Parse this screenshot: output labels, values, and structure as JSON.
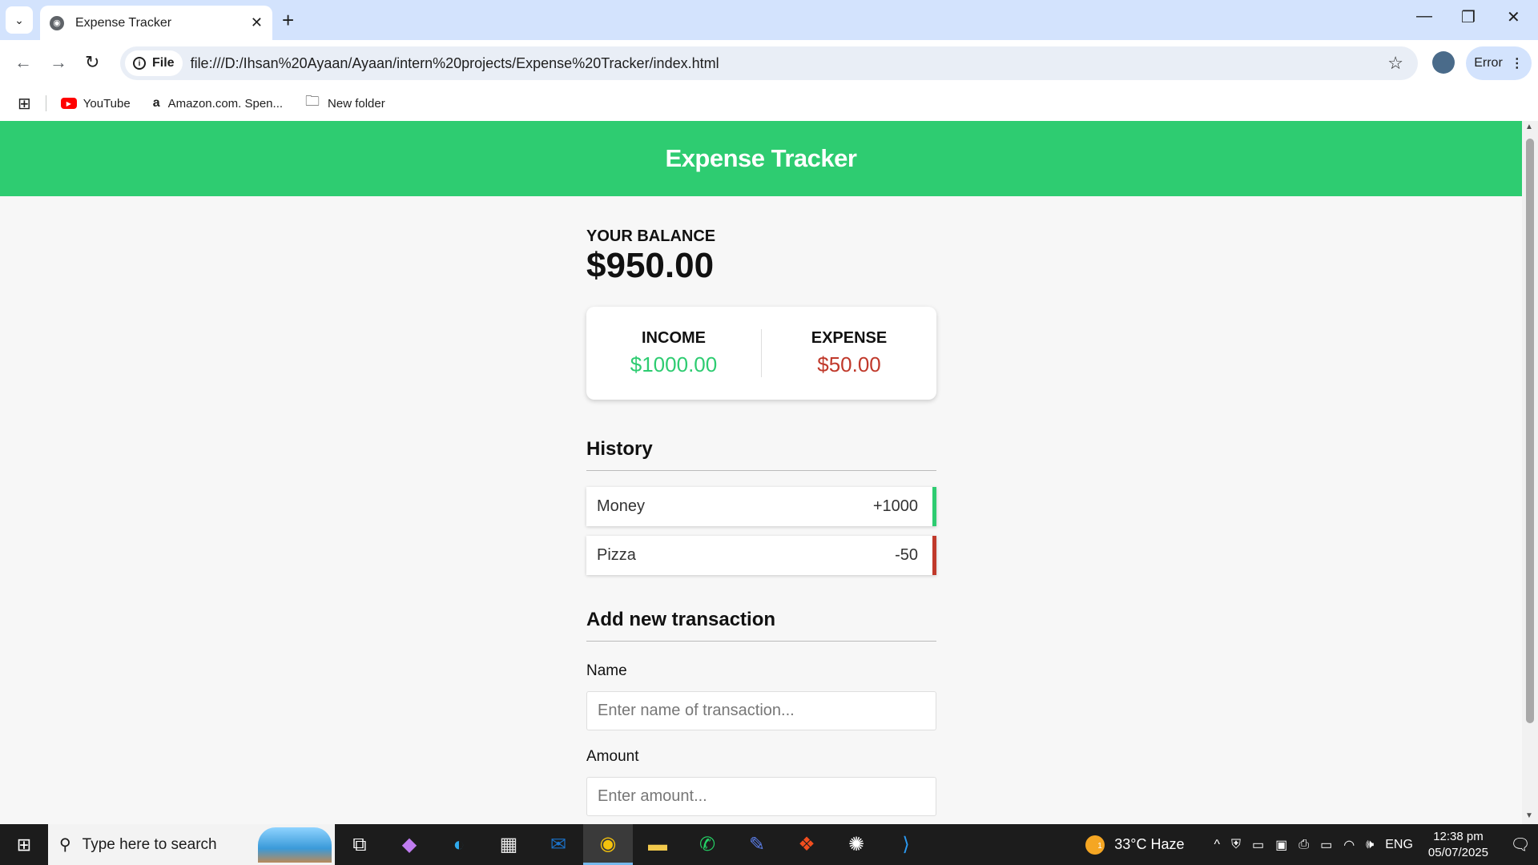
{
  "browser": {
    "tab_title": "Expense Tracker",
    "new_tab": "+",
    "chip_label": "File",
    "url": "file:///D:/Ihsan%20Ayaan/Ayaan/intern%20projects/Expense%20Tracker/index.html",
    "error_label": "Error",
    "bookmarks": [
      {
        "label": "YouTube"
      },
      {
        "label": "Amazon.com. Spen..."
      },
      {
        "label": "New folder"
      }
    ]
  },
  "app": {
    "title": "Expense Tracker",
    "balance_label": "YOUR BALANCE",
    "balance_value": "$950.00",
    "income_label": "INCOME",
    "income_value": "$1000.00",
    "expense_label": "EXPENSE",
    "expense_value": "$50.00",
    "history_title": "History",
    "transactions": [
      {
        "name": "Money",
        "amount": "+1000",
        "type": "plus"
      },
      {
        "name": "Pizza",
        "amount": "-50",
        "type": "minus"
      }
    ],
    "add_title": "Add new transaction",
    "name_label": "Name",
    "name_placeholder": "Enter name of transaction...",
    "amount_label": "Amount",
    "amount_placeholder": "Enter amount..."
  },
  "colors": {
    "accent": "#2ecc71",
    "income": "#2ecc71",
    "expense": "#c0392b"
  },
  "taskbar": {
    "search_placeholder": "Type here to search",
    "weather": "33°C  Haze",
    "language": "ENG",
    "time": "12:38 pm",
    "date": "05/07/2025",
    "weather_badge": "1"
  }
}
